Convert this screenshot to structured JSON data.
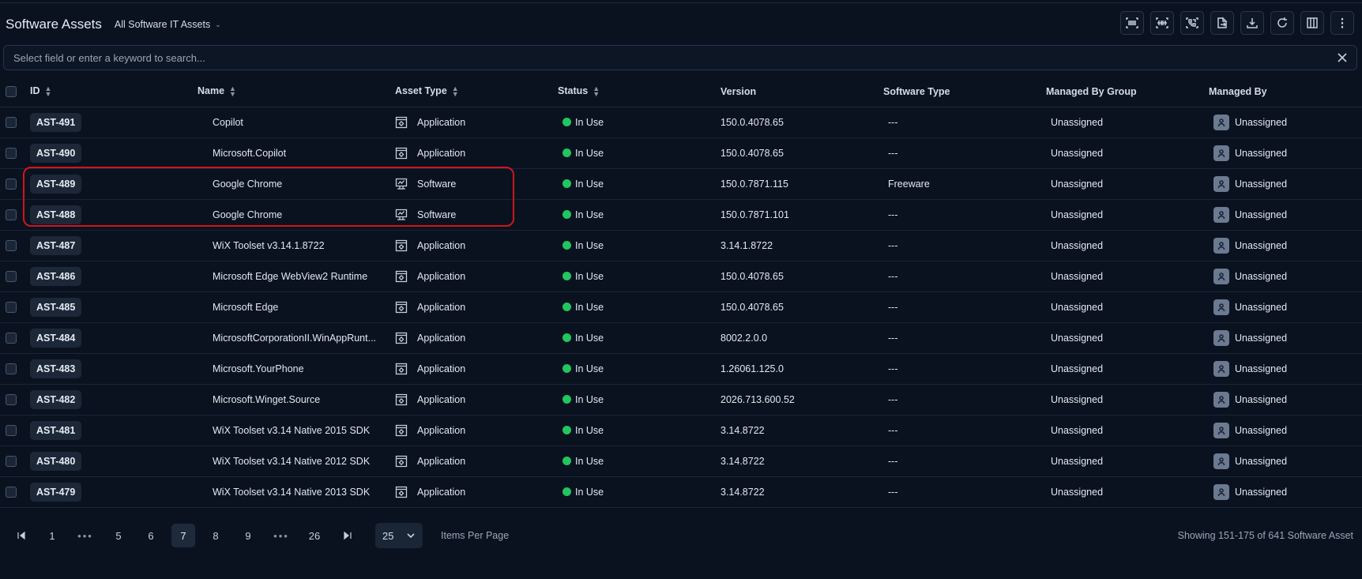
{
  "header": {
    "title": "Software Assets",
    "view_label": "All Software IT Assets"
  },
  "toolbar": {
    "icons": [
      "barcode-icon",
      "barcode-scan-icon",
      "qr-code-icon",
      "export-icon",
      "download-icon",
      "refresh-icon",
      "columns-icon",
      "more-vertical-icon"
    ]
  },
  "search": {
    "placeholder": "Select field or enter a keyword to search..."
  },
  "table": {
    "columns": [
      "ID",
      "Name",
      "Asset Type",
      "Status",
      "Version",
      "Software Type",
      "Managed By Group",
      "Managed By"
    ],
    "rows": [
      {
        "id": "AST-491",
        "name": "Copilot",
        "asset_type": "Application",
        "status": "In Use",
        "version": "150.0.4078.65",
        "software_type": "---",
        "group": "Unassigned",
        "managed_by": "Unassigned"
      },
      {
        "id": "AST-490",
        "name": "Microsoft.Copilot",
        "asset_type": "Application",
        "status": "In Use",
        "version": "150.0.4078.65",
        "software_type": "---",
        "group": "Unassigned",
        "managed_by": "Unassigned"
      },
      {
        "id": "AST-489",
        "name": "Google Chrome",
        "asset_type": "Software",
        "status": "In Use",
        "version": "150.0.7871.115",
        "software_type": "Freeware",
        "group": "Unassigned",
        "managed_by": "Unassigned"
      },
      {
        "id": "AST-488",
        "name": "Google Chrome",
        "asset_type": "Software",
        "status": "In Use",
        "version": "150.0.7871.101",
        "software_type": "---",
        "group": "Unassigned",
        "managed_by": "Unassigned"
      },
      {
        "id": "AST-487",
        "name": "WiX Toolset v3.14.1.8722",
        "asset_type": "Application",
        "status": "In Use",
        "version": "3.14.1.8722",
        "software_type": "---",
        "group": "Unassigned",
        "managed_by": "Unassigned"
      },
      {
        "id": "AST-486",
        "name": "Microsoft Edge WebView2 Runtime",
        "asset_type": "Application",
        "status": "In Use",
        "version": "150.0.4078.65",
        "software_type": "---",
        "group": "Unassigned",
        "managed_by": "Unassigned"
      },
      {
        "id": "AST-485",
        "name": "Microsoft Edge",
        "asset_type": "Application",
        "status": "In Use",
        "version": "150.0.4078.65",
        "software_type": "---",
        "group": "Unassigned",
        "managed_by": "Unassigned"
      },
      {
        "id": "AST-484",
        "name": "MicrosoftCorporationII.WinAppRunt...",
        "asset_type": "Application",
        "status": "In Use",
        "version": "8002.2.0.0",
        "software_type": "---",
        "group": "Unassigned",
        "managed_by": "Unassigned"
      },
      {
        "id": "AST-483",
        "name": "Microsoft.YourPhone",
        "asset_type": "Application",
        "status": "In Use",
        "version": "1.26061.125.0",
        "software_type": "---",
        "group": "Unassigned",
        "managed_by": "Unassigned"
      },
      {
        "id": "AST-482",
        "name": "Microsoft.Winget.Source",
        "asset_type": "Application",
        "status": "In Use",
        "version": "2026.713.600.52",
        "software_type": "---",
        "group": "Unassigned",
        "managed_by": "Unassigned"
      },
      {
        "id": "AST-481",
        "name": "WiX Toolset v3.14 Native 2015 SDK",
        "asset_type": "Application",
        "status": "In Use",
        "version": "3.14.8722",
        "software_type": "---",
        "group": "Unassigned",
        "managed_by": "Unassigned"
      },
      {
        "id": "AST-480",
        "name": "WiX Toolset v3.14 Native 2012 SDK",
        "asset_type": "Application",
        "status": "In Use",
        "version": "3.14.8722",
        "software_type": "---",
        "group": "Unassigned",
        "managed_by": "Unassigned"
      },
      {
        "id": "AST-479",
        "name": "WiX Toolset v3.14 Native 2013 SDK",
        "asset_type": "Application",
        "status": "In Use",
        "version": "3.14.8722",
        "software_type": "---",
        "group": "Unassigned",
        "managed_by": "Unassigned"
      }
    ]
  },
  "pagination": {
    "pages": [
      "1",
      "5",
      "6",
      "7",
      "8",
      "9",
      "26"
    ],
    "current": "7",
    "ellipsis": "•••",
    "per_page": "25",
    "per_page_label": "Items Per Page",
    "showing": "Showing 151-175 of 641 Software Asset"
  },
  "colors": {
    "background": "#0a1220",
    "status_in_use": "#22c55e",
    "highlight": "#d0161c"
  }
}
